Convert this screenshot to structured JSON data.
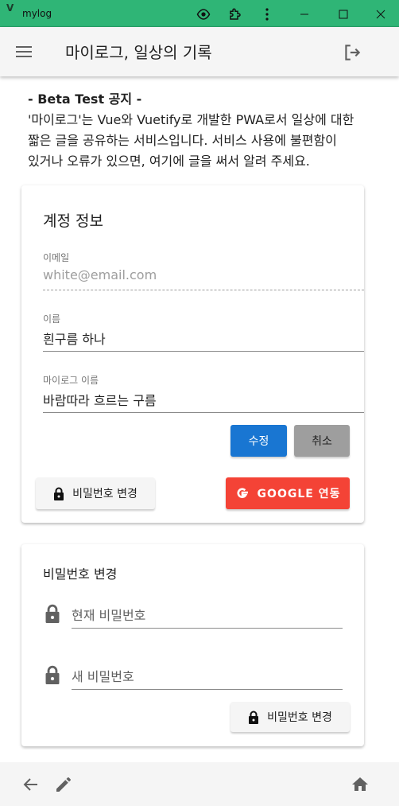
{
  "window": {
    "app_name": "mylog",
    "app_icon": "V"
  },
  "appbar": {
    "title": "마이로그, 일상의 기록"
  },
  "notice": {
    "title": "- Beta Test 공지 -",
    "line1": "'마이로그'는 Vue와 Vuetify로 개발한 PWA로서 일상에 대한",
    "line2": "짧은 글을 공유하는 서비스입니다. 서비스 사용에 불편함이",
    "line3": "있거나 오류가 있으면, 여기에 글을 써서 알려 주세요."
  },
  "account": {
    "title": "계정 정보",
    "email_label": "이메일",
    "email_value": "white@email.com",
    "name_label": "이름",
    "name_value": "흰구름 하나",
    "mylog_name_label": "마이로그 이름",
    "mylog_name_value": "바람따라 흐르는 구름",
    "edit_button": "수정",
    "cancel_button": "취소",
    "change_password_button": "비밀번호 변경",
    "google_link_button": "GOOGLE 연동"
  },
  "password": {
    "title": "비밀번호 변경",
    "current_placeholder": "현재 비밀번호",
    "new_placeholder": "새 비밀번호",
    "submit_button": "비밀번호 변경"
  },
  "icons": [
    "eye-icon",
    "extension-icon",
    "more-vert-icon",
    "minimize-icon",
    "maximize-icon",
    "close-icon",
    "menu-icon",
    "logout-icon",
    "lock-icon",
    "google-icon",
    "arrow-back-icon",
    "pencil-icon",
    "home-icon"
  ],
  "colors": {
    "titlebar": "#2fb576",
    "primary": "#1976d2",
    "google": "#f44336",
    "grey_button": "#9e9e9e"
  }
}
